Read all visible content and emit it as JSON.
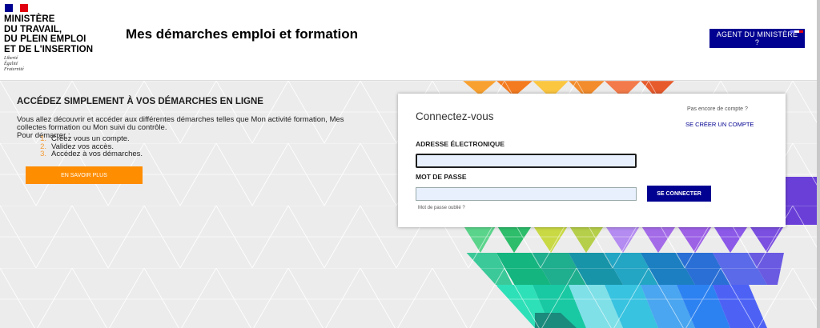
{
  "header": {
    "org_lines": [
      "MINISTÈRE",
      "DU TRAVAIL,",
      "DU PLEIN EMPLOI",
      "ET DE L'INSERTION"
    ],
    "motto": [
      "Liberté",
      "Égalité",
      "Fraternité"
    ],
    "site_title": "Mes démarches emploi et formation",
    "agent_button": "AGENT DU MINISTÈRE ?"
  },
  "intro": {
    "heading": "ACCÉDEZ SIMPLEMENT À VOS DÉMARCHES EN LIGNE",
    "paragraph": "Vous allez découvrir et accéder aux différentes démarches telles que Mon activité formation, Mes collectes formation ou Mon suivi du contrôle.",
    "lead": "Pour démarrer :",
    "steps": [
      {
        "n": "1.",
        "text": "Créez vous un compte."
      },
      {
        "n": "2.",
        "text": "Validez vos accès."
      },
      {
        "n": "3.",
        "text": "Accédez à vos démarches."
      }
    ],
    "more_button": "EN SAVOIR PLUS"
  },
  "login": {
    "title": "Connectez-vous",
    "no_account": "Pas encore de compte ?",
    "create_account": "SE CRÉER UN COMPTE",
    "email_label": "ADRESSE ÉLECTRONIQUE",
    "email_value": "",
    "password_label": "MOT DE PASSE",
    "password_value": "",
    "forgot": "Mot de passe oublié ?",
    "submit": "SE CONNECTER"
  },
  "colors": {
    "primary": "#000091",
    "accent": "#ff8d00",
    "flag_blue": "#000091",
    "flag_white": "#ffffff",
    "flag_red": "#e1000f"
  }
}
